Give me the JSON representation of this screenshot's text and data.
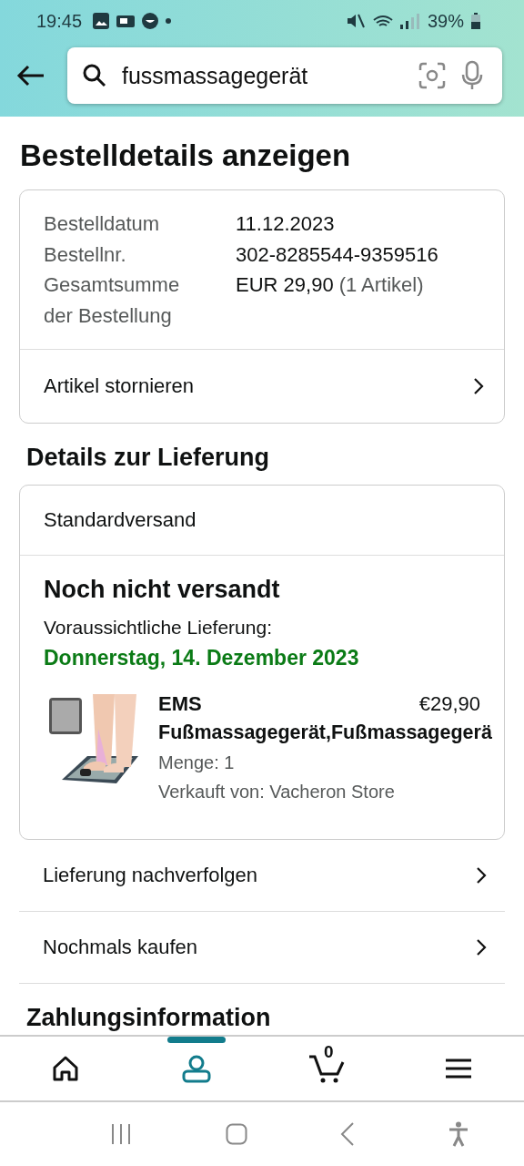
{
  "status_bar": {
    "time": "19:45",
    "battery": "39%"
  },
  "search": {
    "value": "fussmassagegerät"
  },
  "page_title": "Bestelldetails anzeigen",
  "order": {
    "rows": [
      {
        "label": "Bestelldatum",
        "value": "11.12.2023"
      },
      {
        "label": "Bestellnr.",
        "value": "302-8285544-9359516"
      },
      {
        "label": "Gesamtsumme der Bestellung",
        "value": "EUR 29,90",
        "note": "(1 Artikel)"
      }
    ],
    "cancel_link": "Artikel stornieren"
  },
  "delivery": {
    "heading": "Details zur Lieferung",
    "method": "Standardversand",
    "status": "Noch nicht versandt",
    "expected_label": "Voraussichtliche Lieferung:",
    "expected_date": "Donnerstag, 14. Dezember 2023",
    "item": {
      "title_line_1": "EMS",
      "title_line_2": "Fußmassagegerät,Fußmassagegerä",
      "price": "€29,90",
      "quantity": "Menge: 1",
      "seller": "Verkauft von: Vacheron Store"
    }
  },
  "links": [
    "Lieferung nachverfolgen",
    "Nochmals kaufen"
  ],
  "next_heading": "Zahlungsinformation",
  "bottom_nav": [
    {
      "kind": "home",
      "selected": false
    },
    {
      "kind": "account",
      "selected": true
    },
    {
      "kind": "cart",
      "selected": false,
      "count": "0"
    },
    {
      "kind": "menu",
      "selected": false
    }
  ]
}
